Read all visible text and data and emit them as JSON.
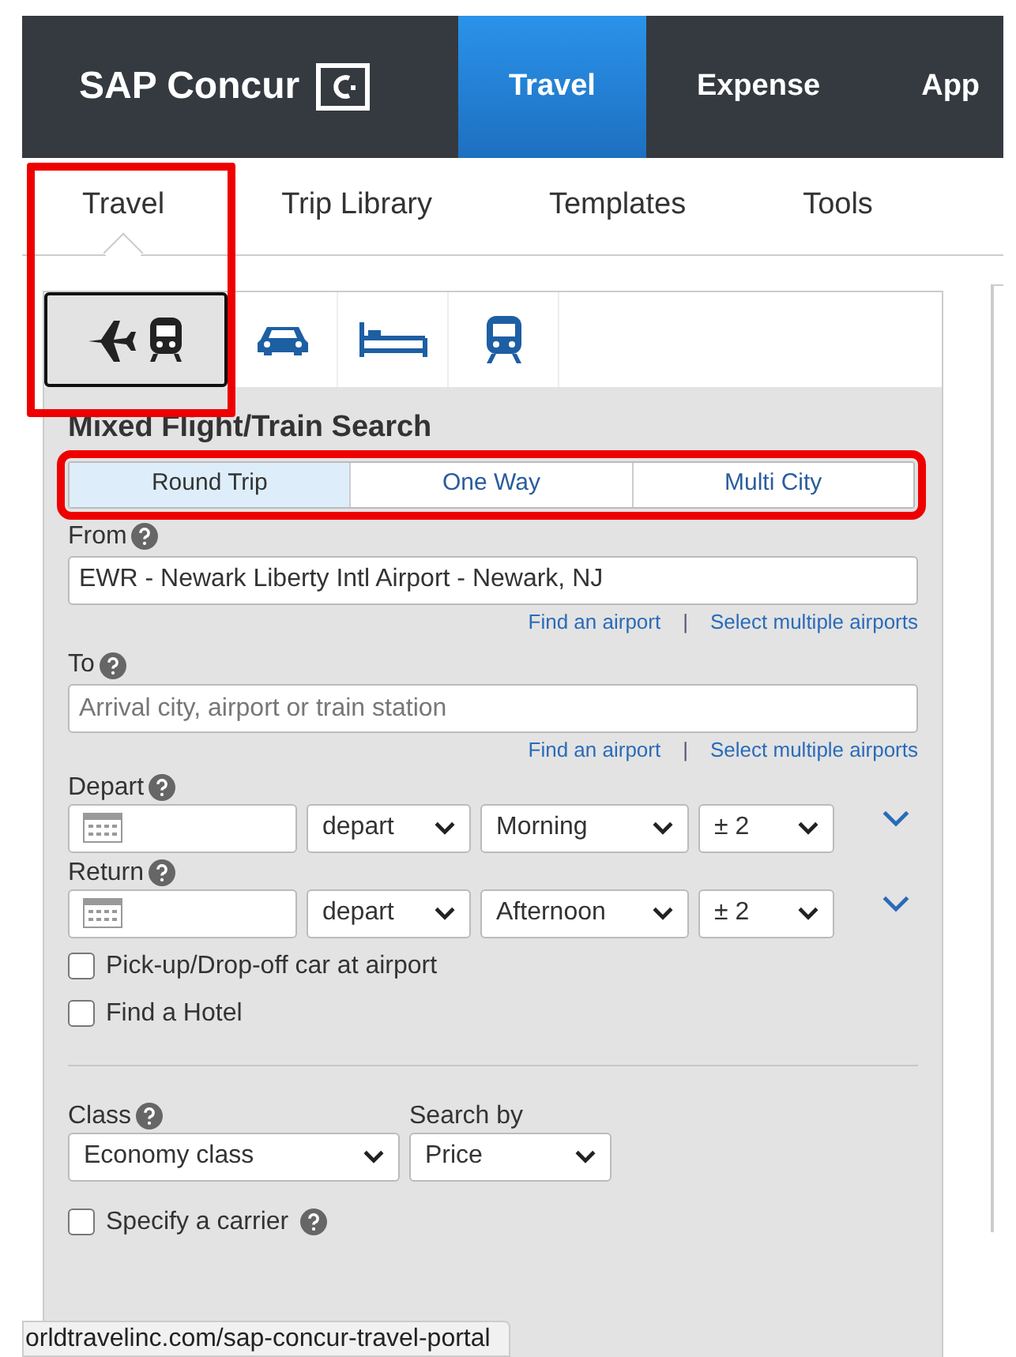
{
  "header": {
    "logo_text": "SAP Concur",
    "nav": [
      {
        "label": "Travel",
        "selected": true
      },
      {
        "label": "Expense",
        "selected": false
      },
      {
        "label": "App",
        "selected": false
      }
    ]
  },
  "travel_highlighted": true,
  "subtabs": [
    {
      "label": "Travel",
      "selected": true
    },
    {
      "label": "Trip Library",
      "selected": false
    },
    {
      "label": "Templates",
      "selected": false
    },
    {
      "label": "Tools",
      "selected": false
    }
  ],
  "mode_tabs": [
    {
      "kind": "flight-train",
      "selected": true
    },
    {
      "kind": "car",
      "selected": false
    },
    {
      "kind": "hotel",
      "selected": false
    },
    {
      "kind": "rail",
      "selected": false
    }
  ],
  "form": {
    "title": "Mixed Flight/Train Search",
    "trip_types_highlighted": true,
    "trip_types": [
      {
        "label": "Round Trip",
        "selected": true
      },
      {
        "label": "One Way",
        "selected": false
      },
      {
        "label": "Multi City",
        "selected": false
      }
    ],
    "locations": [
      {
        "label": "From",
        "value": "EWR - Newark Liberty Intl Airport - Newark, NJ",
        "links": [
          "Find an airport",
          "Select multiple airports"
        ],
        "separator": "|"
      },
      {
        "label": "To",
        "placeholder": "Arrival city, airport or train station",
        "links": [
          "Find an airport",
          "Select multiple airports"
        ],
        "separator": "|"
      }
    ],
    "dates": [
      {
        "label": "Depart",
        "mode": "depart",
        "time": "Morning",
        "range": "± 2"
      },
      {
        "label": "Return",
        "mode": "depart",
        "time": "Afternoon",
        "range": "± 2"
      }
    ],
    "options": [
      {
        "label": "Pick-up/Drop-off car at airport",
        "checked": false
      },
      {
        "label": "Find a Hotel",
        "checked": false
      }
    ],
    "class": {
      "label": "Class",
      "value": "Economy class"
    },
    "search_by": {
      "label": "Search by",
      "value": "Price"
    },
    "carrier": {
      "label": "Specify a carrier",
      "checked": false
    }
  },
  "status_url": "orldtravelinc.com/sap-concur-travel-portal"
}
